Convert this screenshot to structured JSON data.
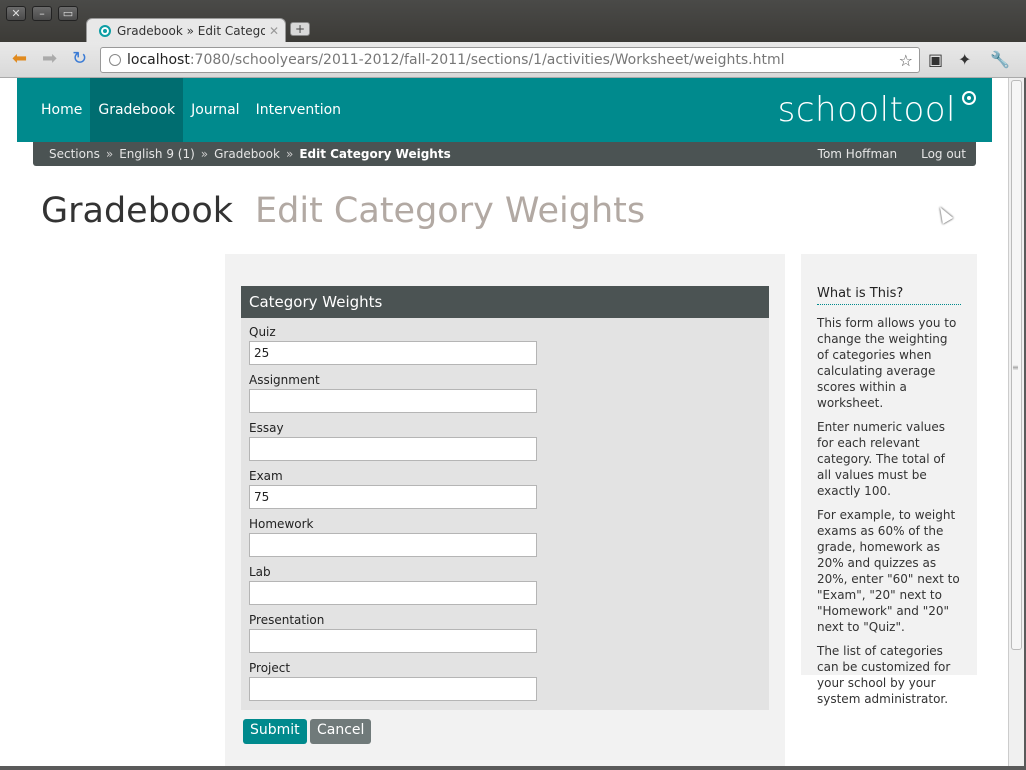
{
  "browser": {
    "tab_title": "Gradebook » Edit Categor",
    "url_host": "localhost",
    "url_path": ":7080/schoolyears/2011-2012/fall-2011/sections/1/activities/Worksheet/weights.html"
  },
  "nav": {
    "items": [
      {
        "label": "Home"
      },
      {
        "label": "Gradebook"
      },
      {
        "label": "Journal"
      },
      {
        "label": "Intervention"
      }
    ],
    "active": "Gradebook",
    "logo": "schooltool",
    "accent_color": "#008a8d"
  },
  "breadcrumb": {
    "items": [
      "Sections",
      "English 9 (1)",
      "Gradebook",
      "Edit Category Weights"
    ],
    "separator": "»",
    "user": "Tom Hoffman",
    "logout": "Log out"
  },
  "page": {
    "title": "Gradebook",
    "subtitle": "Edit Category Weights"
  },
  "form": {
    "legend": "Category Weights",
    "fields": [
      {
        "label": "Quiz",
        "value": "25"
      },
      {
        "label": "Assignment",
        "value": ""
      },
      {
        "label": "Essay",
        "value": ""
      },
      {
        "label": "Exam",
        "value": "75"
      },
      {
        "label": "Homework",
        "value": ""
      },
      {
        "label": "Lab",
        "value": ""
      },
      {
        "label": "Presentation",
        "value": ""
      },
      {
        "label": "Project",
        "value": ""
      }
    ],
    "submit_label": "Submit",
    "cancel_label": "Cancel"
  },
  "help": {
    "title": "What is This?",
    "paragraphs": [
      "This form allows you to change the weighting of categories when calculating average scores within a worksheet.",
      "Enter numeric values for each relevant category. The total of all values must be exactly 100.",
      "For example, to weight exams as 60% of the grade, homework as 20% and quizzes as 20%, enter \"60\" next to \"Exam\", \"20\" next to \"Homework\" and \"20\" next to \"Quiz\".",
      "The list of categories can be customized for your school by your system administrator."
    ]
  }
}
